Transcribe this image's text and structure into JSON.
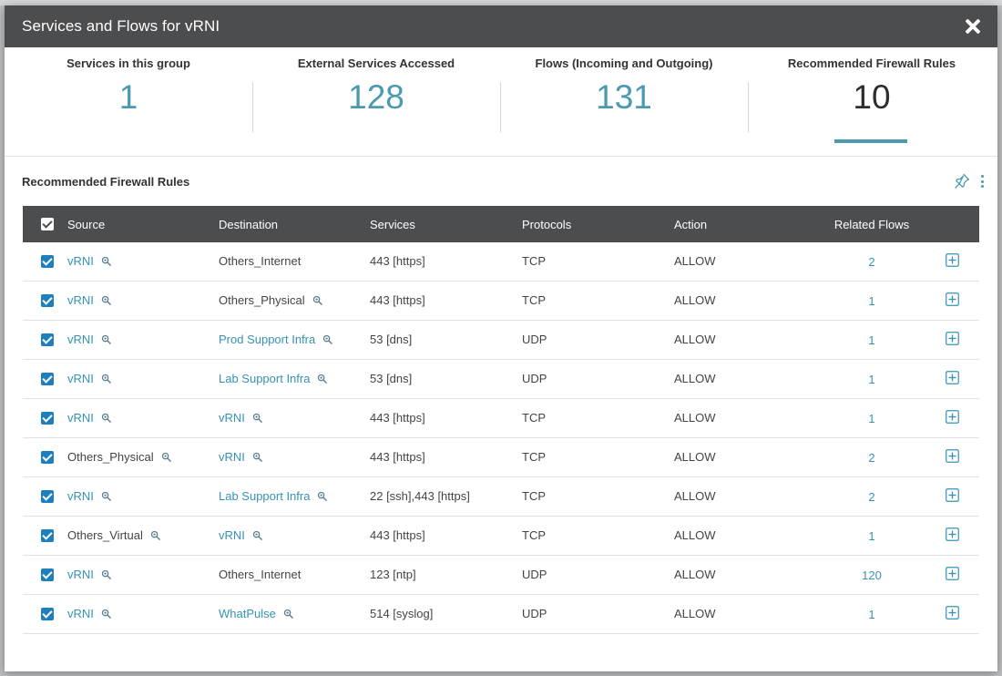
{
  "modal": {
    "title": "Services and Flows for vRNI"
  },
  "stats": [
    {
      "label": "Services in this group",
      "value": "1"
    },
    {
      "label": "External Services Accessed",
      "value": "128"
    },
    {
      "label": "Flows (Incoming and Outgoing)",
      "value": "131"
    },
    {
      "label": "Recommended Firewall Rules",
      "value": "10",
      "active": true
    }
  ],
  "section": {
    "title": "Recommended Firewall Rules"
  },
  "table": {
    "headers": {
      "source": "Source",
      "destination": "Destination",
      "services": "Services",
      "protocols": "Protocols",
      "action": "Action",
      "related_flows": "Related Flows"
    },
    "rows": [
      {
        "source": "vRNI",
        "source_link": true,
        "destination": "Others_Internet",
        "dest_link": false,
        "dest_icon": false,
        "services": "443 [https]",
        "protocol": "TCP",
        "action": "ALLOW",
        "related": "2"
      },
      {
        "source": "vRNI",
        "source_link": true,
        "destination": "Others_Physical",
        "dest_link": false,
        "dest_icon": true,
        "services": "443 [https]",
        "protocol": "TCP",
        "action": "ALLOW",
        "related": "1"
      },
      {
        "source": "vRNI",
        "source_link": true,
        "destination": "Prod Support Infra",
        "dest_link": true,
        "dest_icon": true,
        "services": "53 [dns]",
        "protocol": "UDP",
        "action": "ALLOW",
        "related": "1"
      },
      {
        "source": "vRNI",
        "source_link": true,
        "destination": "Lab Support Infra",
        "dest_link": true,
        "dest_icon": true,
        "services": "53 [dns]",
        "protocol": "UDP",
        "action": "ALLOW",
        "related": "1"
      },
      {
        "source": "vRNI",
        "source_link": true,
        "destination": "vRNI",
        "dest_link": true,
        "dest_icon": true,
        "services": "443 [https]",
        "protocol": "TCP",
        "action": "ALLOW",
        "related": "1"
      },
      {
        "source": "Others_Physical",
        "source_link": false,
        "destination": "vRNI",
        "dest_link": true,
        "dest_icon": true,
        "services": "443 [https]",
        "protocol": "TCP",
        "action": "ALLOW",
        "related": "2"
      },
      {
        "source": "vRNI",
        "source_link": true,
        "destination": "Lab Support Infra",
        "dest_link": true,
        "dest_icon": true,
        "services": "22 [ssh],443 [https]",
        "protocol": "TCP",
        "action": "ALLOW",
        "related": "2"
      },
      {
        "source": "Others_Virtual",
        "source_link": false,
        "destination": "vRNI",
        "dest_link": true,
        "dest_icon": true,
        "services": "443 [https]",
        "protocol": "TCP",
        "action": "ALLOW",
        "related": "1"
      },
      {
        "source": "vRNI",
        "source_link": true,
        "destination": "Others_Internet",
        "dest_link": false,
        "dest_icon": false,
        "services": "123 [ntp]",
        "protocol": "UDP",
        "action": "ALLOW",
        "related": "120"
      },
      {
        "source": "vRNI",
        "source_link": true,
        "destination": "WhatPulse",
        "dest_link": true,
        "dest_icon": true,
        "services": "514 [syslog]",
        "protocol": "UDP",
        "action": "ALLOW",
        "related": "1"
      }
    ]
  },
  "colors": {
    "accent": "#4a9ab0",
    "link": "#3592b5",
    "header_bg": "#4c4d4f",
    "checkbox": "#1e7fbf"
  }
}
